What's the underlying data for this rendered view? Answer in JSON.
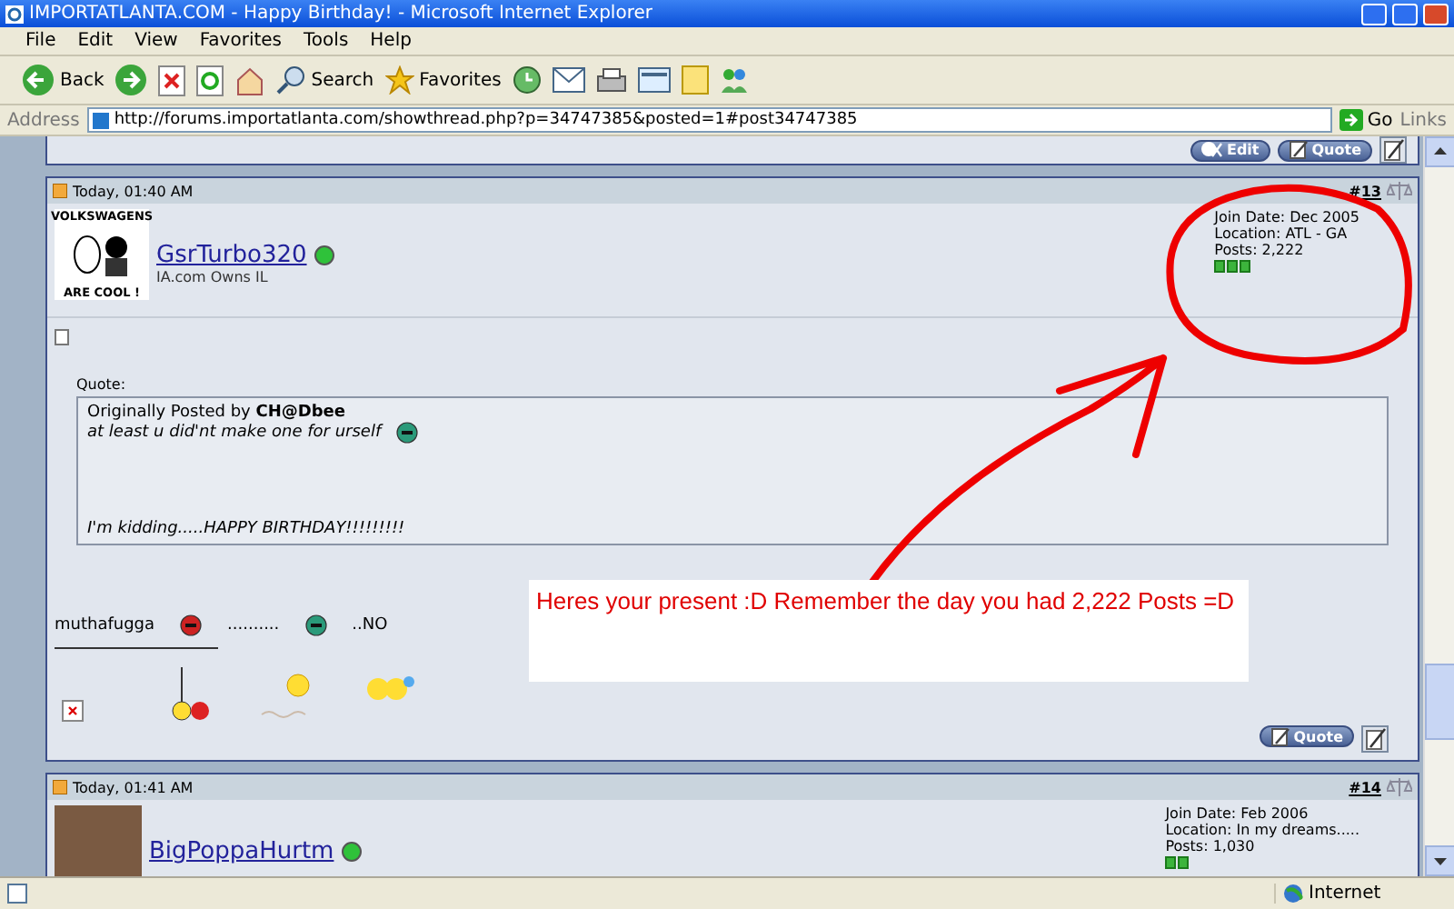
{
  "window": {
    "title": "IMPORTATLANTA.COM - Happy Birthday! - Microsoft Internet Explorer"
  },
  "menu": [
    "File",
    "Edit",
    "View",
    "Favorites",
    "Tools",
    "Help"
  ],
  "toolbar": {
    "back": "Back",
    "search": "Search",
    "favorites": "Favorites"
  },
  "address_bar": {
    "label": "Address",
    "url": "http://forums.importatlanta.com/showthread.php?p=34747385&posted=1#post34747385",
    "go": "Go",
    "links": "Links"
  },
  "previous_post": {
    "buttons": [
      "Edit",
      "Quote"
    ]
  },
  "posts": [
    {
      "date": "Today, 01:40 AM",
      "number": "#13",
      "username": "GsrTurbo320",
      "online": true,
      "user_title": "IA.com Owns IL",
      "avatar_text": [
        "VOLKSWAGENS",
        "ARE COOL !"
      ],
      "join_date": "Join Date: Dec 2005",
      "location": "Location: ATL - GA",
      "post_count": "Posts: 2,222",
      "quote": {
        "heading": "Quote:",
        "attribution": "Originally Posted by **CH@Dbee**",
        "lines": [
          "at least u did'nt make one for urself",
          "I'm kidding.....HAPPY BIRTHDAY!!!!!!!!!"
        ]
      },
      "message": [
        "muthafugga",
        "..........",
        "..NO"
      ],
      "buttons": [
        "Quote"
      ]
    },
    {
      "date": "Today, 01:41 AM",
      "number": "#14",
      "username": "BigPoppaHurtm",
      "online": true,
      "join_date": "Join Date: Feb 2006",
      "location": "Location: In my dreams.....",
      "post_count": "Posts: 1,030"
    }
  ],
  "annotation": {
    "text": "Heres your present :D Remember the day you had 2,222 Posts =D"
  },
  "status_bar": {
    "zone": "Internet"
  }
}
